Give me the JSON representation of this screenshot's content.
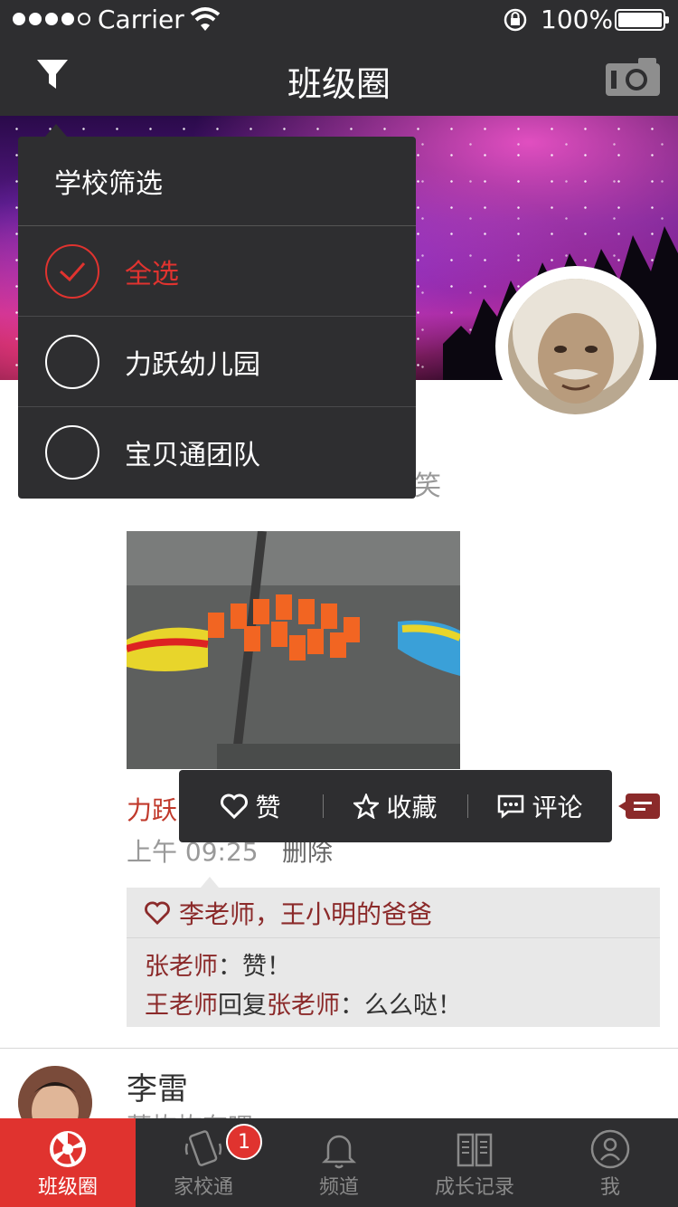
{
  "status_bar": {
    "carrier": "Carrier",
    "battery": "100%"
  },
  "nav": {
    "title": "班级圈",
    "filter_icon": "filter-icon",
    "camera_icon": "camera-icon"
  },
  "filter_dropdown": {
    "header": "学校筛选",
    "options": [
      {
        "label": "全选",
        "selected": true
      },
      {
        "label": "力跃幼儿园",
        "selected": false
      },
      {
        "label": "宝贝通团队",
        "selected": false
      }
    ]
  },
  "post1": {
    "text_fragment": "笑",
    "school": "力跃",
    "time": "上午 09:25",
    "delete_label": "删除",
    "actions": {
      "like": "赞",
      "favorite": "收藏",
      "comment": "评论"
    },
    "likes": "李老师，王小明的爸爸",
    "comments": [
      {
        "author": "张老师",
        "reply_to": "",
        "reply_word": "",
        "text": "：赞！"
      },
      {
        "author": "王老师",
        "reply_word": "回复",
        "reply_to": "张老师",
        "text": "：么么哒！"
      }
    ]
  },
  "post2": {
    "name": "李雷",
    "text_fragment": "莫恢恢有嘿"
  },
  "tabbar": {
    "tabs": [
      {
        "label": "班级圈",
        "active": true
      },
      {
        "label": "家校通",
        "badge": "1"
      },
      {
        "label": "频道"
      },
      {
        "label": "成长记录"
      },
      {
        "label": "我"
      }
    ]
  },
  "colors": {
    "accent": "#e0332f",
    "dark": "#2e2e30",
    "name_color": "#8b2a2a"
  }
}
